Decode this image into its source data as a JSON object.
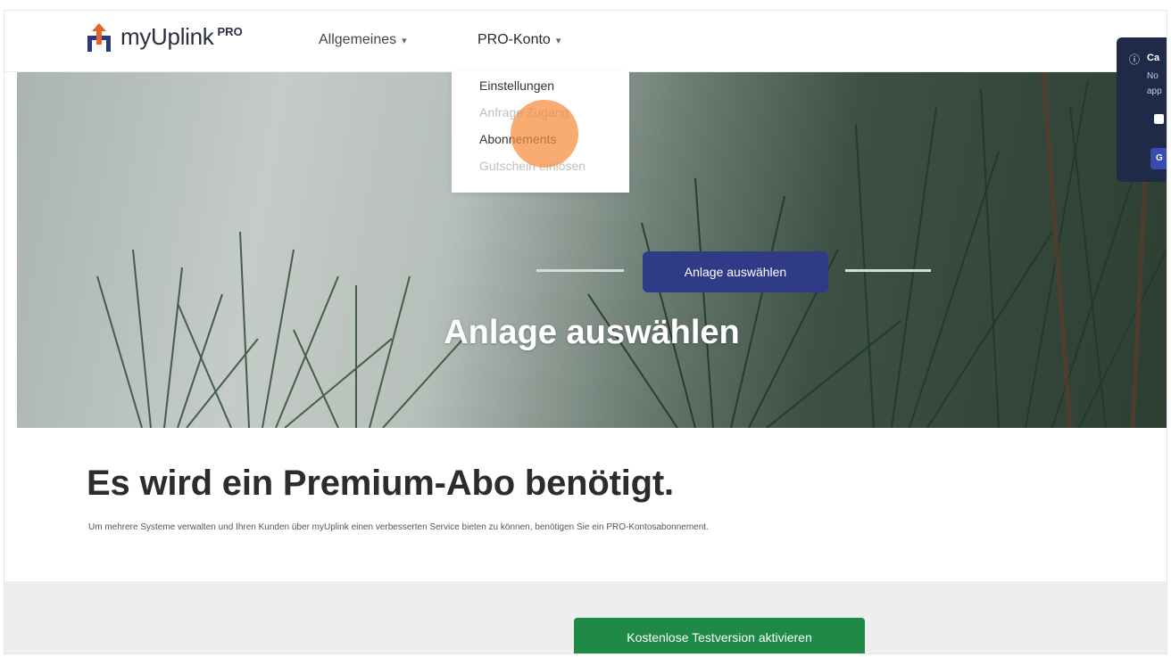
{
  "header": {
    "logo_text": "myUplink",
    "logo_badge": "PRO",
    "nav": [
      {
        "label": "Allgemeines",
        "chevron": "▾"
      },
      {
        "label": "PRO-Konto",
        "chevron": "▾"
      }
    ]
  },
  "dropdown": {
    "items": [
      {
        "label": "Einstellungen",
        "enabled": true
      },
      {
        "label": "Anfrage Zugang",
        "enabled": false
      },
      {
        "label": "Abonnements",
        "enabled": true
      },
      {
        "label": "Gutschein einlösen",
        "enabled": false
      }
    ]
  },
  "hero": {
    "step_label": "Anlage auswählen",
    "title": "Anlage auswählen"
  },
  "notice": {
    "info_icon": "ⓘ",
    "title": "Ca",
    "line1": "No",
    "line2": "app",
    "button": "G"
  },
  "main": {
    "title": "Es wird ein Premium-Abo benötigt.",
    "description": "Um mehrere Systeme verwalten und Ihren Kunden über myUplink einen verbesserten Service bieten zu können, benötigen Sie ein PRO-Kontosabonnement.",
    "cta": "Kostenlose Testversion aktivieren"
  },
  "colors": {
    "brand_navy": "#2f3b86",
    "cta_green": "#1e8a45",
    "click_highlight": "#f58c3c",
    "logo_orange": "#e8632b"
  }
}
